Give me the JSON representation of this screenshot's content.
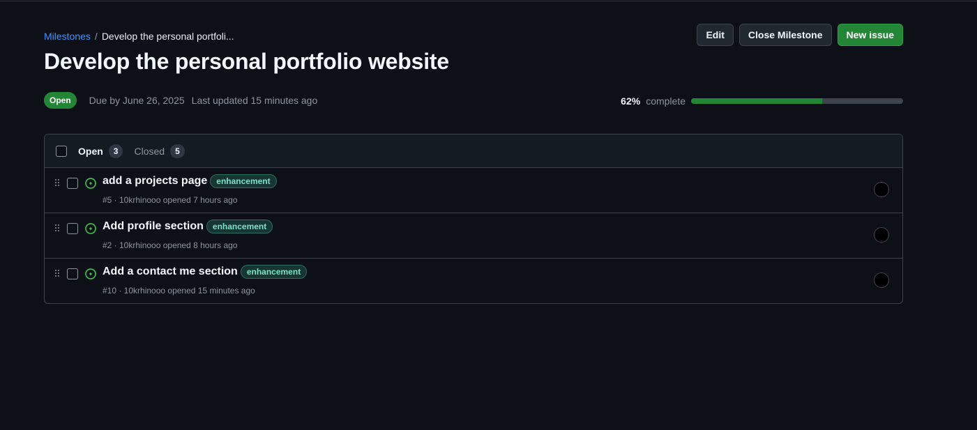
{
  "breadcrumb": {
    "parent": "Milestones",
    "separator": "/",
    "current": "Develop the personal portfoli..."
  },
  "milestone": {
    "title": "Develop the personal portfolio website",
    "state": "Open",
    "due": "Due by June 26, 2025",
    "updated": "Last updated 15 minutes ago",
    "progress_percent": 62,
    "progress_text": "62%",
    "progress_suffix": "complete"
  },
  "actions": {
    "edit": "Edit",
    "close": "Close Milestone",
    "new_issue": "New issue"
  },
  "filters": {
    "open_label": "Open",
    "open_count": "3",
    "closed_label": "Closed",
    "closed_count": "5"
  },
  "issues": [
    {
      "title": "add a projects page",
      "label": "enhancement",
      "meta": "#5 · 10krhinooo opened 7 hours ago"
    },
    {
      "title": "Add profile section",
      "label": "enhancement",
      "meta": "#2 · 10krhinooo opened 8 hours ago"
    },
    {
      "title": "Add a contact me section",
      "label": "enhancement",
      "meta": "#10 · 10krhinooo opened 15 minutes ago"
    }
  ],
  "colors": {
    "accent_green": "#238636",
    "link_blue": "#4493f8",
    "label_text": "#7ee2c9"
  }
}
